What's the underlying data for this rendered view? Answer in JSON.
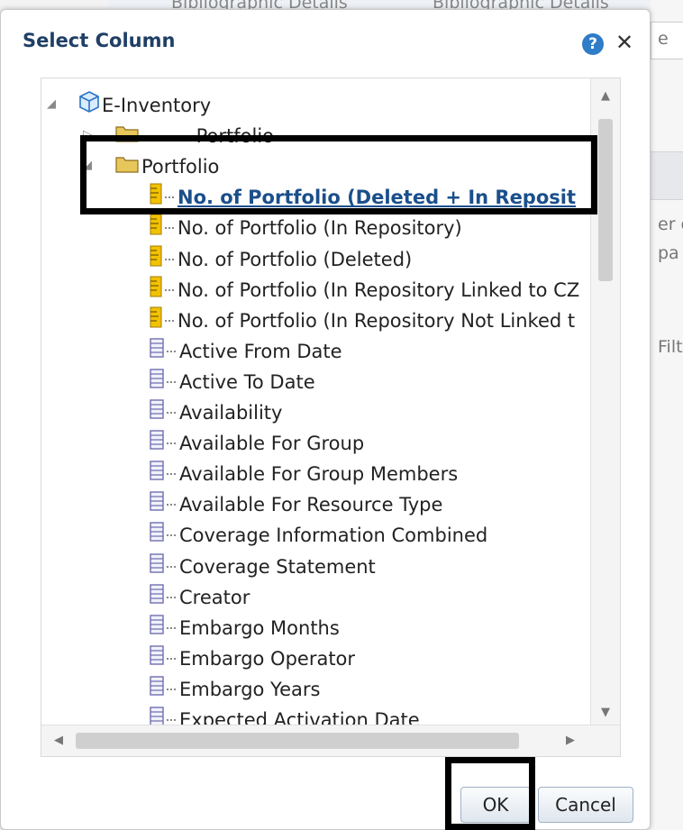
{
  "background": {
    "top_fragments": [
      "Bibliographic Details",
      "Bibliographic Details"
    ],
    "right_fragments": [
      "e",
      "er o",
      "pa",
      "Filt"
    ]
  },
  "dialog": {
    "title": "Select Column",
    "help_glyph": "?",
    "close_glyph": "✕"
  },
  "tree": {
    "root": "E-Inventory",
    "folders": [
      "--------Portfolio------------------------",
      "Portfolio"
    ],
    "items": [
      "No. of Portfolio (Deleted + In Reposit",
      "No. of Portfolio (In Repository)",
      "No. of Portfolio (Deleted)",
      "No. of Portfolio (In Repository Linked to CZ",
      "No. of Portfolio (In Repository Not Linked t",
      "Active From Date",
      "Active To Date",
      "Availability",
      "Available For Group",
      "Available For Group Members",
      "Available For Resource Type",
      "Coverage Information Combined",
      "Coverage Statement",
      "Creator",
      "Embargo Months",
      "Embargo Operator",
      "Embargo Years",
      "Expected Activation Date"
    ],
    "measure_count": 5,
    "selected_index": 0
  },
  "icons": {
    "root": "cube-icon",
    "folder": "folder-icon",
    "measure": "measure-column-icon",
    "attribute": "attribute-column-icon"
  },
  "colors": {
    "title": "#1f3f66",
    "selected_text": "#1a4f8b",
    "folder": "#e8c75a",
    "measure": "#f2c200",
    "attribute": "#6f6fb0",
    "highlight": "#000000"
  },
  "buttons": {
    "ok": "OK",
    "cancel": "Cancel"
  }
}
